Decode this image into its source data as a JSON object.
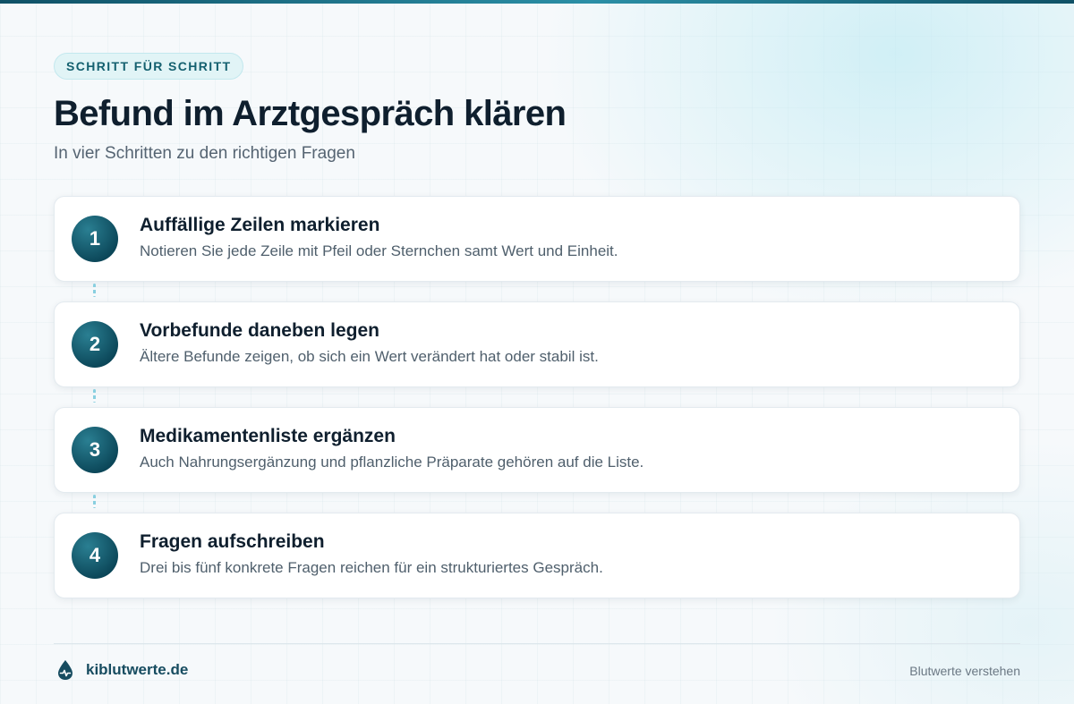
{
  "header": {
    "eyebrow": "SCHRITT FÜR SCHRITT",
    "title": "Befund im Arztgespräch klären",
    "subtitle": "In vier Schritten zu den richtigen Fragen"
  },
  "steps": [
    {
      "number": "1",
      "title": "Auffällige Zeilen markieren",
      "description": "Notieren Sie jede Zeile mit Pfeil oder Sternchen samt Wert und Einheit."
    },
    {
      "number": "2",
      "title": "Vorbefunde daneben legen",
      "description": "Ältere Befunde zeigen, ob sich ein Wert verändert hat oder stabil ist."
    },
    {
      "number": "3",
      "title": "Medikamentenliste ergänzen",
      "description": "Auch Nahrungsergänzung und pflanzliche Präparate gehören auf die Liste."
    },
    {
      "number": "4",
      "title": "Fragen aufschreiben",
      "description": "Drei bis fünf konkrete Fragen reichen für ein strukturiertes Gespräch."
    }
  ],
  "footer": {
    "brand": "kiblutwerte.de",
    "brand_icon": "blood-drop-pulse-icon",
    "tagline": "Blutwerte verstehen"
  },
  "colors": {
    "accent": "#0b4658",
    "accent_light": "#2a7f92",
    "eyebrow_bg": "#e1f4f6",
    "connector": "#89cfe0",
    "title_text": "#0f1f2e"
  }
}
